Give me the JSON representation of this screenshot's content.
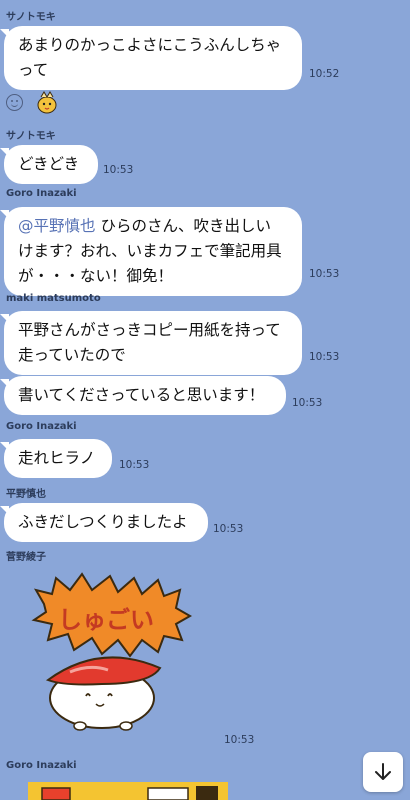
{
  "messages": [
    {
      "sender": "サノトモキ",
      "lines": [
        "あまりのかっこよさにこうふんしちゃ",
        "って"
      ],
      "time": "10:52"
    },
    {
      "sender": "サノトモキ",
      "text": "どきどき",
      "time": "10:53"
    },
    {
      "sender": "Goro Inazaki",
      "mention": "@平野慎也",
      "lines_after_mention": [
        "ひらのさん、吹き出しい",
        "けます？おれ、いまカフェで筆記用具",
        "が・・・ない！御免！"
      ],
      "time": "10:53"
    },
    {
      "sender": "maki matsumoto",
      "lines": [
        "平野さんがさっきコピー用紙を持って",
        "走っていたので"
      ],
      "time": "10:53"
    },
    {
      "text": "書いてくださっていると思います！",
      "time": "10:53"
    },
    {
      "sender": "Goro Inazaki",
      "text": "走れヒラノ",
      "time": "10:53"
    },
    {
      "sender": "平野慎也",
      "text": "ふきだしつくりましたよ",
      "time": "10:53"
    },
    {
      "sender": "菅野綾子",
      "sticker_text": "しゅごい",
      "time": "10:53"
    },
    {
      "sender": "Goro Inazaki"
    }
  ],
  "icons": {
    "reaction": "smiley-outline-icon",
    "reaction_sticker": "chick-sticker-icon",
    "scroll_down": "arrow-down-icon"
  },
  "colors": {
    "background": "#8aa6d8",
    "bubble": "#ffffff",
    "mention": "#5772b5",
    "sticker_banner": "#f08a28",
    "sushi_topping": "#e23a2e"
  }
}
